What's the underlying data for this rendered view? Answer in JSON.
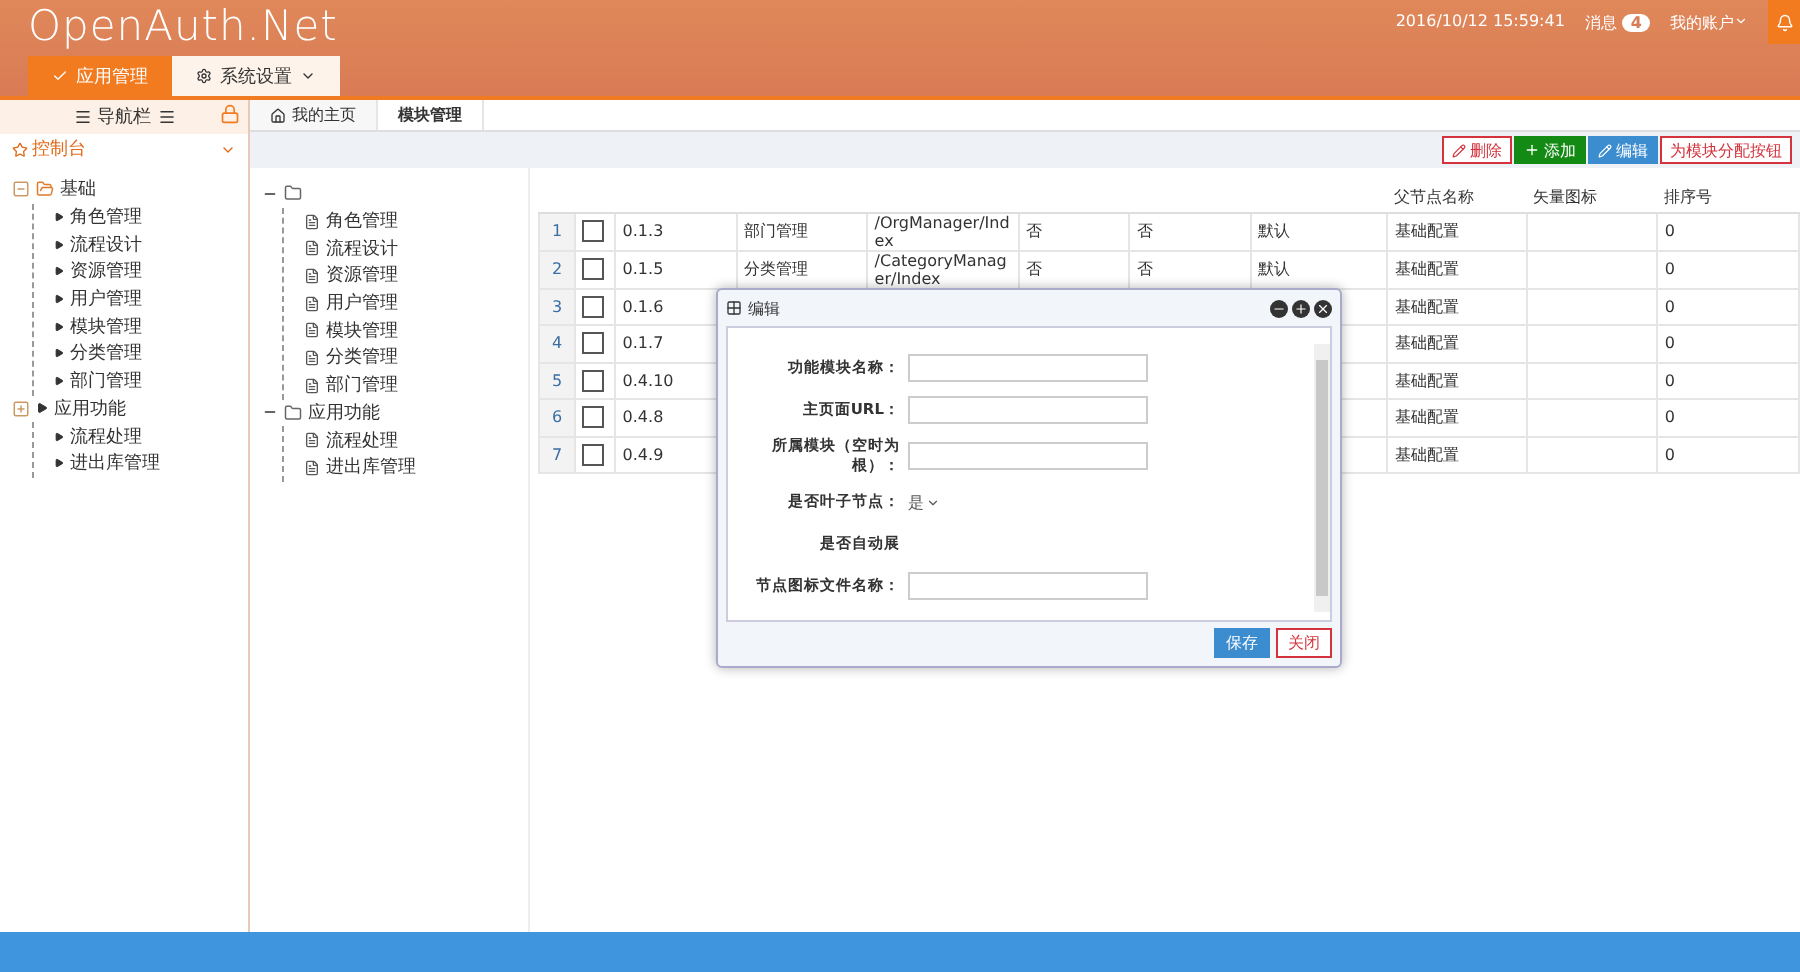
{
  "header": {
    "logo": "OpenAuth.Net",
    "top_tabs": [
      {
        "label": "应用管理",
        "selected": true,
        "caret": false
      },
      {
        "label": "系统设置",
        "selected": false,
        "caret": true
      }
    ],
    "datetime": "2016/10/12 15:59:41",
    "messages": {
      "label": "消息",
      "count": "4"
    },
    "account": "我的账户"
  },
  "sidebar": {
    "title": "导航栏",
    "console": "控制台",
    "tree": [
      {
        "label": "基础",
        "expanded": true,
        "children": [
          {
            "label": "角色管理"
          },
          {
            "label": "流程设计"
          },
          {
            "label": "资源管理"
          },
          {
            "label": "用户管理"
          },
          {
            "label": "模块管理"
          },
          {
            "label": "分类管理"
          },
          {
            "label": "部门管理"
          }
        ]
      },
      {
        "label": "应用功能",
        "expanded": false,
        "children": [
          {
            "label": "流程处理"
          },
          {
            "label": "进出库管理"
          }
        ]
      }
    ]
  },
  "page_tabs": [
    {
      "label": "我的主页",
      "selected": false,
      "kind": "home"
    },
    {
      "label": "模块管理",
      "selected": true,
      "kind": "page"
    }
  ],
  "toolbar": [
    {
      "label": "删除",
      "kind": "delete"
    },
    {
      "label": "添加",
      "kind": "add"
    },
    {
      "label": "编辑",
      "kind": "edit"
    },
    {
      "label": "为模块分配按钮",
      "kind": "assign"
    }
  ],
  "module_tree": [
    {
      "children": [
        {
          "label": "角色管理"
        },
        {
          "label": "流程设计"
        },
        {
          "label": "资源管理"
        },
        {
          "label": "用户管理"
        },
        {
          "label": "模块管理"
        },
        {
          "label": "分类管理"
        },
        {
          "label": "部门管理"
        }
      ]
    },
    {
      "label": "应用功能",
      "children": [
        {
          "label": "流程处理"
        },
        {
          "label": "进出库管理"
        }
      ]
    }
  ],
  "table": {
    "columns": [
      "",
      "",
      "",
      "",
      "",
      "",
      "父节点名称",
      "矢量图标",
      "排序号"
    ],
    "rows": [
      {
        "index": "1",
        "checked": false,
        "cells": [
          "0.1.3",
          "部门管理",
          "/OrgManager/Index",
          "否",
          "否",
          "默认",
          "基础配置",
          "",
          "0"
        ]
      },
      {
        "index": "2",
        "checked": false,
        "cells": [
          "0.1.5",
          "分类管理",
          "/CategoryManager/Index",
          "否",
          "否",
          "默认",
          "基础配置",
          "",
          "0"
        ]
      },
      {
        "index": "3",
        "checked": false,
        "cells": [
          "0.1.6",
          "",
          "",
          "",
          "",
          "",
          "基础配置",
          "",
          "0"
        ]
      },
      {
        "index": "4",
        "checked": false,
        "cells": [
          "0.1.7",
          "",
          "",
          "",
          "",
          "",
          "基础配置",
          "",
          "0"
        ]
      },
      {
        "index": "5",
        "checked": false,
        "cells": [
          "0.4.10",
          "",
          "",
          "",
          "",
          "",
          "基础配置",
          "",
          "0"
        ]
      },
      {
        "index": "6",
        "checked": false,
        "cells": [
          "0.4.8",
          "",
          "",
          "",
          "",
          "",
          "基础配置",
          "",
          "0"
        ]
      },
      {
        "index": "7",
        "checked": false,
        "cells": [
          "0.4.9",
          "",
          "",
          "",
          "",
          "",
          "基础配置",
          "",
          "0"
        ]
      }
    ]
  },
  "dialog": {
    "title": "编辑",
    "fields": [
      {
        "label": "功能模块名称：",
        "kind": "text"
      },
      {
        "label": "主页面URL：",
        "kind": "text"
      },
      {
        "label": "所属模块（空时为根）：",
        "kind": "text"
      },
      {
        "label": "是否叶子节点：",
        "kind": "select",
        "value": "是"
      },
      {
        "label": "是否自动展",
        "kind": "none"
      },
      {
        "label": "节点图标文件名称：",
        "kind": "text"
      }
    ],
    "buttons": [
      {
        "label": "保存",
        "kind": "primary"
      },
      {
        "label": "关闭",
        "kind": "danger"
      }
    ]
  }
}
